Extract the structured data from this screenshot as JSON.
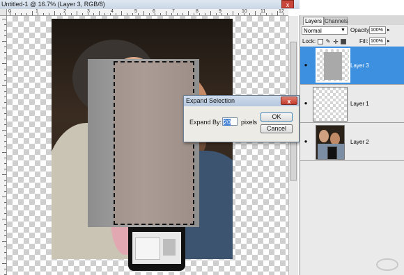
{
  "document": {
    "title": "Untitled-1 @ 16.7% (Layer 3, RGB/8)",
    "close_glyph": "x",
    "ruler_labels": [
      "0",
      "1",
      "2",
      "3",
      "4",
      "5",
      "6",
      "7",
      "8",
      "9",
      "10",
      "11",
      "12"
    ]
  },
  "dialog": {
    "title": "Expand Selection",
    "close_glyph": "x",
    "expand_label": "Expand By:",
    "expand_value": "20",
    "units": "pixels",
    "ok_label": "OK",
    "cancel_label": "Cancel"
  },
  "layers_panel": {
    "tabs": [
      {
        "label": "Layers",
        "active": true
      },
      {
        "label": "Channels",
        "active": false
      }
    ],
    "blend_mode": "Normal",
    "opacity_label": "Opacity:",
    "opacity_value": "100%",
    "lock_label": "Lock:",
    "fill_label": "Fill:",
    "fill_value": "100%",
    "layers": [
      {
        "name": "Layer 3",
        "selected": true
      },
      {
        "name": "Layer 1",
        "selected": false
      },
      {
        "name": "Layer 2",
        "selected": false
      }
    ]
  },
  "colors": {
    "selected_layer": "#3d8fe0",
    "dialog_title_bar": "#c4d4e8",
    "close_red": "#c9473a"
  },
  "icons": [
    "eye-icon",
    "close-icon",
    "chevron-down-icon",
    "lock-transparency-icon",
    "lock-paint-icon",
    "lock-move-icon",
    "lock-all-icon"
  ]
}
